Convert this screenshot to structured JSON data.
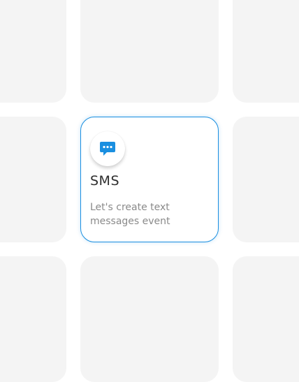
{
  "colors": {
    "accent": "#1a8fe0",
    "placeholder_tile": "#f4f4f4",
    "background": "#ffffff"
  },
  "sms_card": {
    "icon": "chat-bubble-icon",
    "title": "SMS",
    "description": "Let's create text messages event"
  }
}
